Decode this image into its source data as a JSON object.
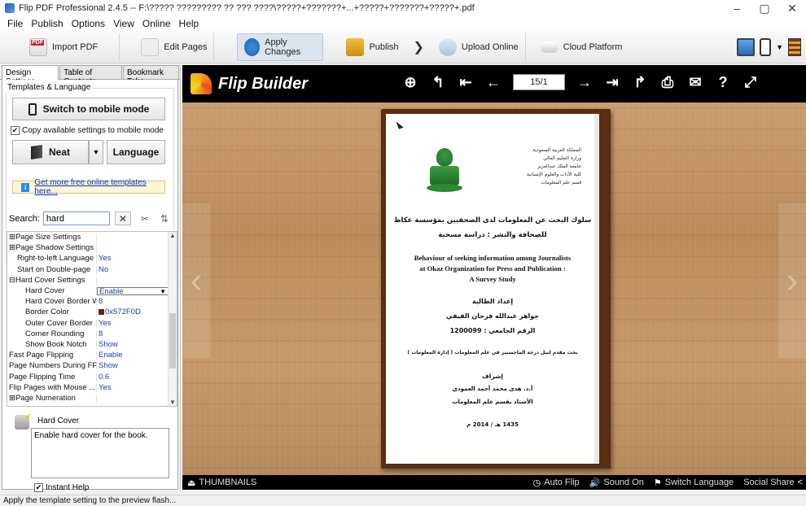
{
  "window": {
    "title": "Flip PDF Professional 2.4.5  -- F:\\????? ????????? ?? ??? ????\\?????+???????+...+?????+???????+?????+.pdf",
    "minimize": "–",
    "maximize": "▢",
    "close": "✕"
  },
  "menu": [
    "File",
    "Publish",
    "Options",
    "View",
    "Online",
    "Help"
  ],
  "toolbar": {
    "import_pdf": "Import PDF",
    "edit_pages": "Edit Pages",
    "apply_changes": "Apply Changes",
    "publish": "Publish",
    "chevron": "❯",
    "upload_online": "Upload Online",
    "cloud_platform": "Cloud Platform",
    "dropdown": "▼"
  },
  "left_panel": {
    "tabs": [
      "Design Settings",
      "Table of Contents",
      "Bookmark Tabs"
    ],
    "group_title": "Templates & Language",
    "switch_mobile": "Switch to mobile mode",
    "copy_settings": "Copy available settings to mobile mode",
    "copy_checked": "✔",
    "neat": "Neat",
    "neat_dropdown": "▼",
    "language": "Language",
    "more_templates": "Get more free online templates here...",
    "info_glyph": "i",
    "search_label": "Search:",
    "search_value": "hard",
    "clear_glyph": "✕",
    "tool1": "✂",
    "tool2": "⇅",
    "properties": [
      {
        "name": "⊞Page Size Settings",
        "value": "",
        "level": 0
      },
      {
        "name": "⊞Page Shadow Settings",
        "value": "",
        "level": 0
      },
      {
        "name": "Right-to-left Language",
        "value": "Yes",
        "level": 1
      },
      {
        "name": "Start on Double-page",
        "value": "No",
        "level": 1
      },
      {
        "name": "⊟Hard Cover Settings",
        "value": "",
        "level": 0
      },
      {
        "name": "Hard Cover",
        "value": "Enable",
        "level": 2,
        "selected": true
      },
      {
        "name": "Hard Cover Border Wi...",
        "value": "8",
        "level": 2
      },
      {
        "name": "Border Color",
        "value": "0x572F0D",
        "level": 2,
        "swatch": "#572F0D"
      },
      {
        "name": "Outer Cover Border",
        "value": "Yes",
        "level": 2
      },
      {
        "name": "Corner Rounding",
        "value": "8",
        "level": 2
      },
      {
        "name": "Show Book Notch",
        "value": "Show",
        "level": 2
      },
      {
        "name": "Fast Page Flipping",
        "value": "Enable",
        "level": 0
      },
      {
        "name": "Page Numbers During FPF",
        "value": "Show",
        "level": 0
      },
      {
        "name": "Page Flipping Time",
        "value": "0.6",
        "level": 0
      },
      {
        "name": "Flip Pages with Mouse ...",
        "value": "Yes",
        "level": 0
      },
      {
        "name": "⊞Page Numeration",
        "value": "",
        "level": 0
      }
    ],
    "help_title": "Hard Cover",
    "help_text": "Enable hard cover for the book.",
    "instant_help": "Instant Help",
    "instant_checked": "✔"
  },
  "preview": {
    "brand": "Flip Builder",
    "page_indicator": "15/1",
    "nav_icons": {
      "zoom": "⊕",
      "back": "↰",
      "first": "⇤",
      "prev": "←",
      "next": "→",
      "last": "⇥",
      "share": "↱",
      "print": "⎙",
      "mail": "✉",
      "help": "?",
      "fullscreen": "⤢"
    },
    "left_arrow": "‹",
    "right_arrow": "›",
    "document": {
      "header_lines": [
        "المملكة العربية السعودية",
        "وزارة التعليم العالي",
        "جامعة الملك عبدالعزيز",
        "كلية الآداب والعلوم الإنسانية",
        "قسم علم المعلومات"
      ],
      "title_ar_1": "سلوك البحث عن المعلومات لدى الصحفيين بمؤسسة عكاظ",
      "title_ar_2": "للصحافة والنشر : دراسة مسحية",
      "title_en_1": "Behaviour of seeking information among Journalists",
      "title_en_2": "at Okaz Organization for Press and Publication :",
      "title_en_3": "A Survey Study",
      "prepared_by": "إعداد الطالبة",
      "student_name": "جواهر عبدالله فرحان الفيفي",
      "student_id": "الرقم الجامعي : 1200099",
      "degree": "بحث مقدم لنيل درجة الماجستير في علم المعلومات ( إدارة المعلومات )",
      "supervision": "إشراف",
      "supervisor": "أ.د. هدى محمد أحمد العمودي",
      "supervisor_title": "الأستاذ بقسم علم المعلومات",
      "year": "1435 هـ / 2014 م"
    },
    "footer": {
      "thumbnails": "THUMBNAILS",
      "thumb_icon": "⏏",
      "auto_flip": "Auto Flip",
      "auto_flip_icon": "◷",
      "sound_on": "Sound On",
      "sound_icon": "🔊",
      "switch_language": "Switch Language",
      "flag_icon": "⚑",
      "social_share": "Social Share",
      "share_icon": "<"
    }
  },
  "status": "Apply the template setting to the preview flash..."
}
